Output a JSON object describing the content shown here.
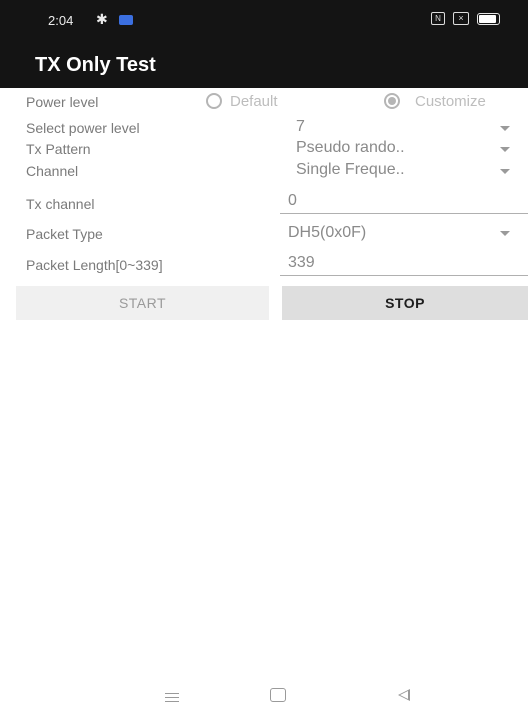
{
  "statusbar": {
    "time": "2:04",
    "icons": [
      "settings-gear-icon",
      "notification-app-icon",
      "nfc-icon",
      "no-sim-icon",
      "battery-icon"
    ]
  },
  "appbar": {
    "title": "TX Only Test"
  },
  "power_level": {
    "label": "Power level",
    "options": [
      "Default",
      "Customize"
    ],
    "selected": "Customize"
  },
  "select_power_level": {
    "label": "Select power level",
    "value": "7"
  },
  "tx_pattern": {
    "label": "Tx Pattern",
    "value": "Pseudo rando.."
  },
  "channel": {
    "label": "Channel",
    "value": "Single Freque.."
  },
  "tx_channel": {
    "label": "Tx channel",
    "value": "0"
  },
  "packet_type": {
    "label": "Packet Type",
    "value": "DH5(0x0F)"
  },
  "packet_length": {
    "label": "Packet Length[0~339]",
    "value": "339"
  },
  "buttons": {
    "start": "START",
    "stop": "STOP"
  },
  "navbar": {
    "icons": [
      "menu-icon",
      "home-icon",
      "back-icon"
    ]
  },
  "colors": {
    "appbar": "#141414",
    "label": "#7a7a7a",
    "stop_button": "#dedede"
  }
}
